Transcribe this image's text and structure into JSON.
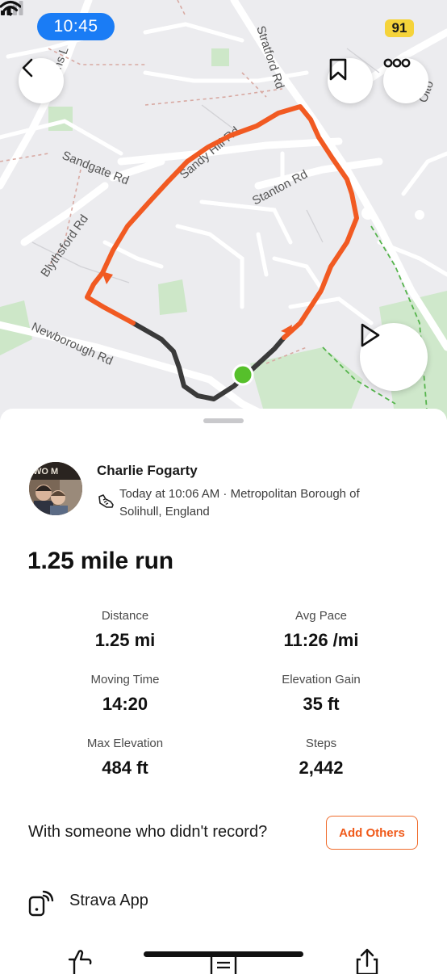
{
  "status_bar": {
    "time": "10:45",
    "battery": "91",
    "battery_color": "#f5d33a",
    "time_pill_color": "#1a7cf5"
  },
  "map": {
    "road_labels": {
      "stratford": "Stratford Rd",
      "sandy_hill": "Sandy Hill Rd",
      "sandgate": "Sandgate Rd",
      "stanton": "Stanton Rd",
      "blythsford": "Blythsford Rd",
      "newborough": "Newborough Rd",
      "olton": "Olto",
      "top_left": "ins L"
    },
    "route_color": "#f15a22",
    "route_dim_color": "#3a3a3a",
    "start_marker_color": "#56c02b",
    "buttons": {
      "back": "chevron-left-icon",
      "bookmark": "bookmark-icon",
      "more": "more-icon",
      "play": "play-icon"
    }
  },
  "athlete": {
    "name": "Charlie Fogarty",
    "meta": "Today at 10:06 AM · Metropolitan Borough of Solihull, England",
    "avatar_sign": "WO M"
  },
  "activity": {
    "title": "1.25 mile run"
  },
  "stats": [
    {
      "label": "Distance",
      "value": "1.25 mi"
    },
    {
      "label": "Avg Pace",
      "value": "11:26 /mi"
    },
    {
      "label": "Moving Time",
      "value": "14:20"
    },
    {
      "label": "Elevation Gain",
      "value": "35 ft"
    },
    {
      "label": "Max Elevation",
      "value": "484 ft"
    },
    {
      "label": "Steps",
      "value": "2,442"
    }
  ],
  "others": {
    "prompt": "With someone who didn't record?",
    "button": "Add Others",
    "accent": "#f05a1a"
  },
  "device": {
    "name": "Strava App",
    "icon": "device-connect-icon"
  },
  "actions": [
    "like-icon",
    "comment-icon",
    "share-icon"
  ]
}
